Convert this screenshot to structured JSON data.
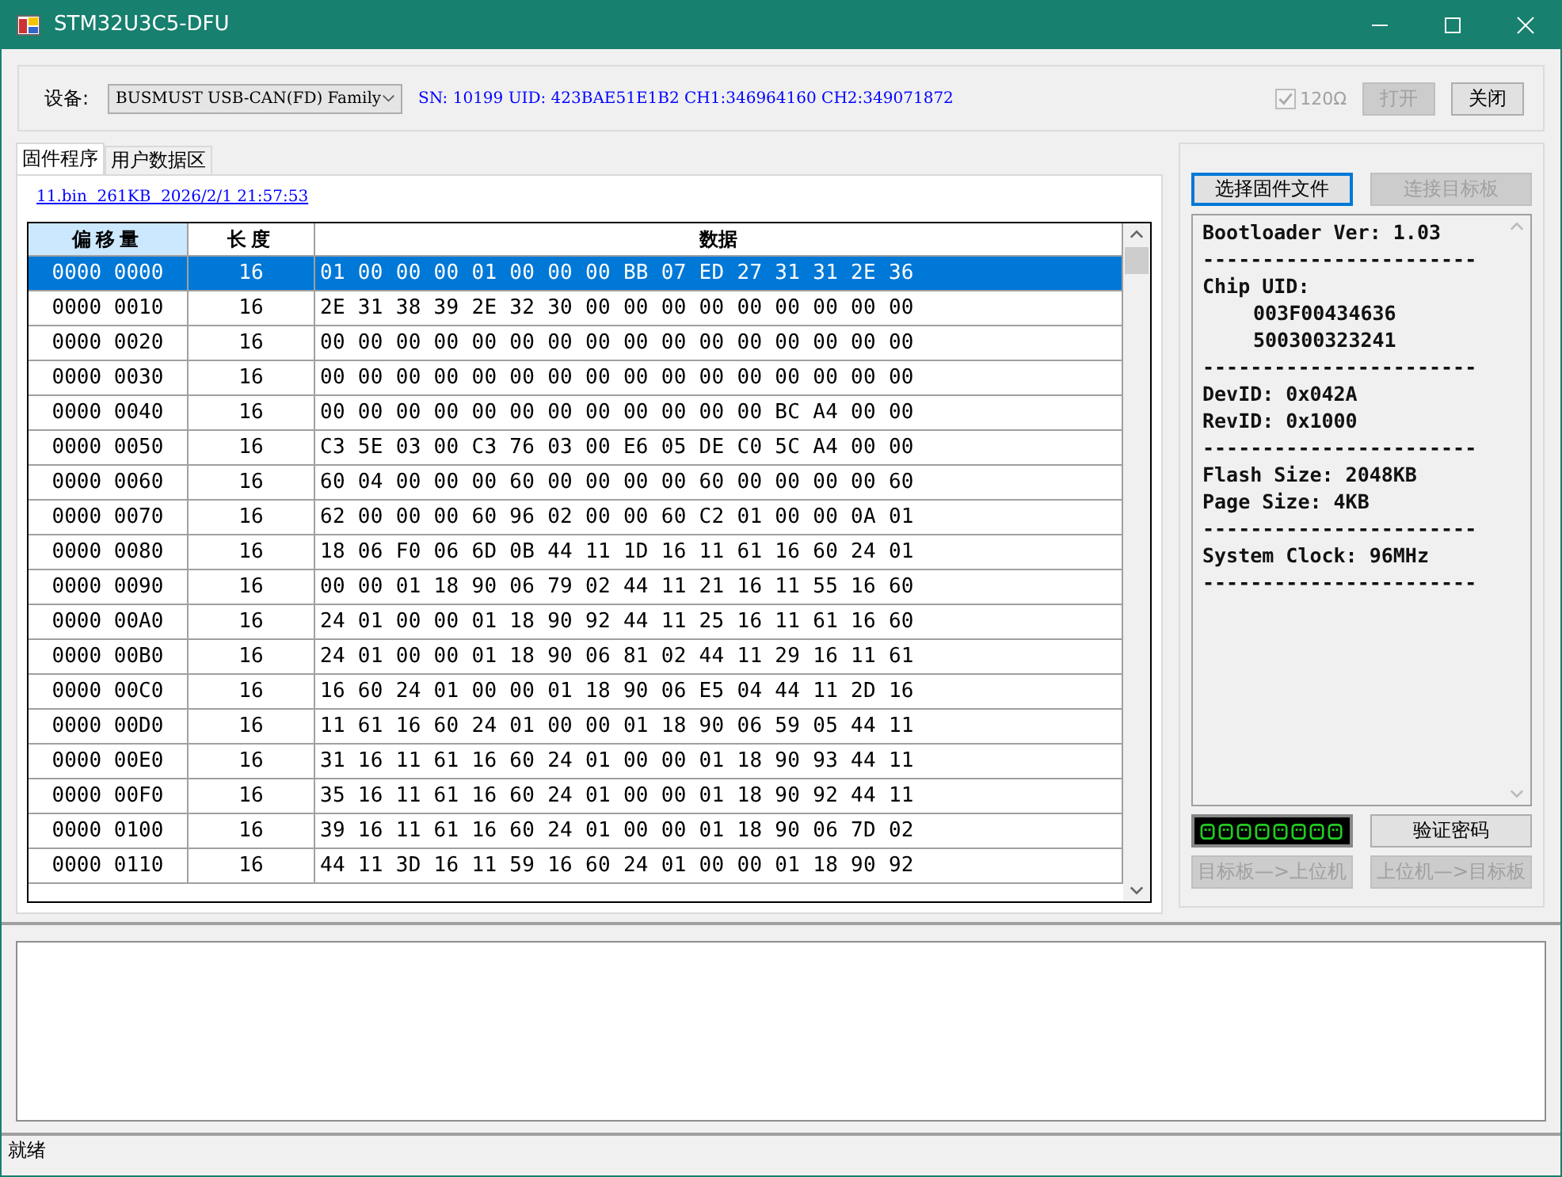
{
  "window": {
    "title": "STM32U3C5-DFU"
  },
  "device": {
    "label": "设备:",
    "value": "BUSMUST USB-CAN(FD) Family",
    "info": "SN: 10199 UID: 423BAE51E1B2 CH1:346964160 CH2:349071872",
    "termination": {
      "label": "120Ω",
      "checked": true,
      "disabled": true
    },
    "buttons": [
      {
        "label": "打开",
        "disabled": true
      },
      {
        "label": "关闭",
        "disabled": false
      }
    ]
  },
  "tabs": [
    {
      "label": "固件程序",
      "selected": true
    },
    {
      "label": "用户数据区",
      "selected": false
    }
  ],
  "file_link": "11.bin  261KB  2026/2/1 21:57:53",
  "table": {
    "columns": [
      {
        "label": "偏移量",
        "selected": true
      },
      {
        "label": "长度",
        "selected": false
      },
      {
        "label": "数据",
        "selected": false
      }
    ],
    "rows": [
      {
        "offset": "0000 0000",
        "length": "16",
        "data": "01 00 00 00 01 00 00 00 BB 07 ED 27 31 31 2E 36",
        "selected": true
      },
      {
        "offset": "0000 0010",
        "length": "16",
        "data": "2E 31 38 39 2E 32 30 00 00 00 00 00 00 00 00 00",
        "selected": false
      },
      {
        "offset": "0000 0020",
        "length": "16",
        "data": "00 00 00 00 00 00 00 00 00 00 00 00 00 00 00 00",
        "selected": false
      },
      {
        "offset": "0000 0030",
        "length": "16",
        "data": "00 00 00 00 00 00 00 00 00 00 00 00 00 00 00 00",
        "selected": false
      },
      {
        "offset": "0000 0040",
        "length": "16",
        "data": "00 00 00 00 00 00 00 00 00 00 00 00 BC A4 00 00",
        "selected": false
      },
      {
        "offset": "0000 0050",
        "length": "16",
        "data": "C3 5E 03 00 C3 76 03 00 E6 05 DE C0 5C A4 00 00",
        "selected": false
      },
      {
        "offset": "0000 0060",
        "length": "16",
        "data": "60 04 00 00 00 60 00 00 00 00 60 00 00 00 00 60",
        "selected": false
      },
      {
        "offset": "0000 0070",
        "length": "16",
        "data": "62 00 00 00 60 96 02 00 00 60 C2 01 00 00 0A 01",
        "selected": false
      },
      {
        "offset": "0000 0080",
        "length": "16",
        "data": "18 06 F0 06 6D 0B 44 11 1D 16 11 61 16 60 24 01",
        "selected": false
      },
      {
        "offset": "0000 0090",
        "length": "16",
        "data": "00 00 01 18 90 06 79 02 44 11 21 16 11 55 16 60",
        "selected": false
      },
      {
        "offset": "0000 00A0",
        "length": "16",
        "data": "24 01 00 00 01 18 90 92 44 11 25 16 11 61 16 60",
        "selected": false
      },
      {
        "offset": "0000 00B0",
        "length": "16",
        "data": "24 01 00 00 01 18 90 06 81 02 44 11 29 16 11 61",
        "selected": false
      },
      {
        "offset": "0000 00C0",
        "length": "16",
        "data": "16 60 24 01 00 00 01 18 90 06 E5 04 44 11 2D 16",
        "selected": false
      },
      {
        "offset": "0000 00D0",
        "length": "16",
        "data": "11 61 16 60 24 01 00 00 01 18 90 06 59 05 44 11",
        "selected": false
      },
      {
        "offset": "0000 00E0",
        "length": "16",
        "data": "31 16 11 61 16 60 24 01 00 00 01 18 90 93 44 11",
        "selected": false
      },
      {
        "offset": "0000 00F0",
        "length": "16",
        "data": "35 16 11 61 16 60 24 01 00 00 01 18 90 92 44 11",
        "selected": false
      },
      {
        "offset": "0000 0100",
        "length": "16",
        "data": "39 16 11 61 16 60 24 01 00 00 01 18 90 06 7D 02",
        "selected": false
      },
      {
        "offset": "0000 0110",
        "length": "16",
        "data": "44 11 3D 16 11 59 16 60 24 01 00 00 01 18 90 92",
        "selected": false
      }
    ]
  },
  "side_buttons": [
    {
      "label": "选择固件文件",
      "disabled": false
    },
    {
      "label": "连接目标板",
      "disabled": true
    }
  ],
  "chip_info": [
    {
      "kind": "line",
      "text": "Bootloader Ver: 1.03"
    },
    {
      "kind": "line",
      "text": "-----------------------"
    },
    {
      "kind": "line",
      "text": "Chip UID:"
    },
    {
      "kind": "indent",
      "text": "003F00434636"
    },
    {
      "kind": "indent",
      "text": "500300323241"
    },
    {
      "kind": "line",
      "text": "-----------------------"
    },
    {
      "kind": "line",
      "text": "DevID: 0x042A"
    },
    {
      "kind": "line",
      "text": "RevID: 0x1000"
    },
    {
      "kind": "line",
      "text": "-----------------------"
    },
    {
      "kind": "line",
      "text": "Flash Size: 2048KB"
    },
    {
      "kind": "line",
      "text": "Page Size: 4KB"
    },
    {
      "kind": "line",
      "text": "-----------------------"
    },
    {
      "kind": "line",
      "text": "System Clock: 96MHz"
    },
    {
      "kind": "line",
      "text": "-----------------------"
    }
  ],
  "verify_button": {
    "label": "验证密码",
    "disabled": false
  },
  "transfer_buttons": [
    {
      "label": "目标板—>上位机",
      "disabled": true
    },
    {
      "label": "上位机—>目标板",
      "disabled": true
    }
  ],
  "status_bar": "就绪"
}
